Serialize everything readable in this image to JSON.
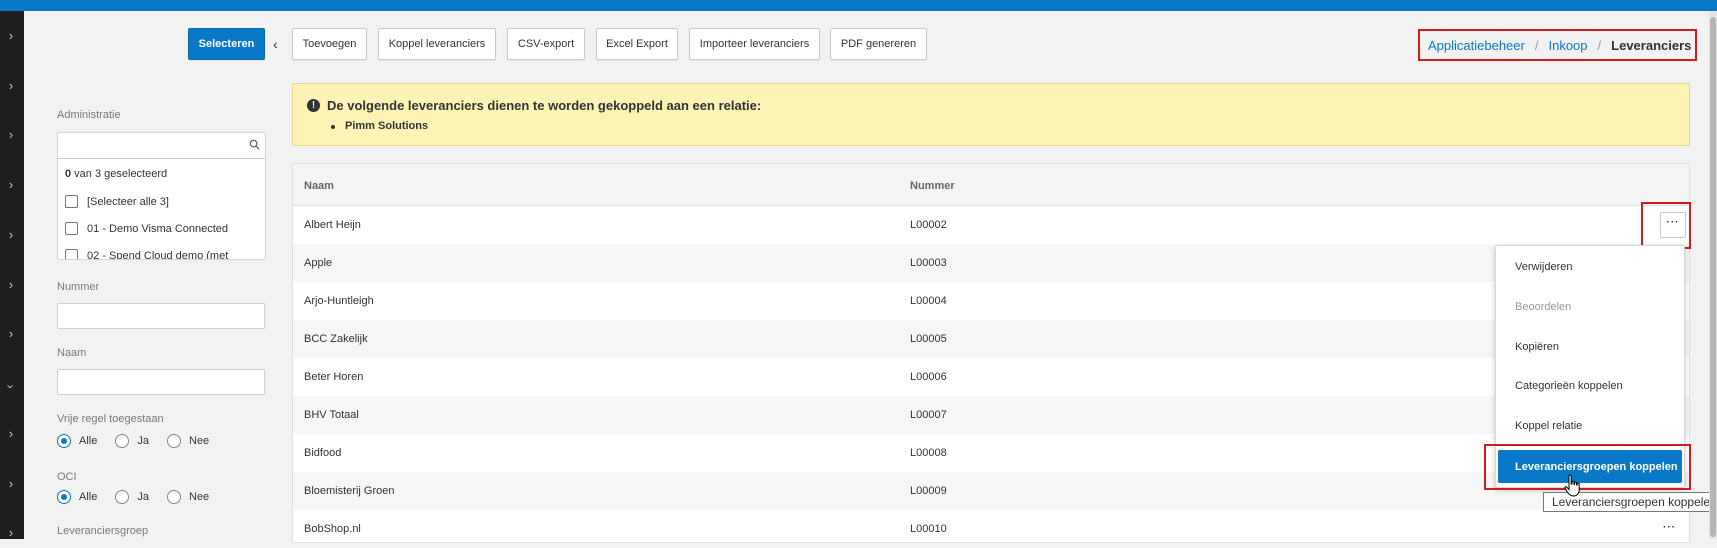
{
  "toolbar": {
    "select_label": "Selecteren",
    "buttons": [
      "Toevoegen",
      "Koppel leveranciers",
      "CSV-export",
      "Excel Export",
      "Importeer leveranciers",
      "PDF genereren"
    ]
  },
  "breadcrumb": {
    "items": [
      "Applicatiebeheer",
      "Inkoop"
    ],
    "current": "Leveranciers",
    "separator": "/"
  },
  "filters": {
    "administratie_label": "Administratie",
    "admin_count_number": "0",
    "admin_count_text": " van 3 geselecteerd",
    "admin_options": [
      "[Selecteer alle 3]",
      "01 - Demo Visma Connected",
      "02 - Spend Cloud demo (met"
    ],
    "nummer_label": "Nummer",
    "naam_label": "Naam",
    "vrije_regel_label": "Vrije regel toegestaan",
    "oci_label": "OCI",
    "radio_options": [
      "Alle",
      "Ja",
      "Nee"
    ],
    "leveranciersgroep_label": "Leveranciersgroep"
  },
  "alert": {
    "title": "De volgende leveranciers dienen te worden gekoppeld aan een relatie:",
    "items": [
      "Pimm Solutions"
    ]
  },
  "table": {
    "columns": [
      "Naam",
      "Nummer"
    ],
    "rows": [
      {
        "naam": "Albert Heijn",
        "nummer": "L00002"
      },
      {
        "naam": "Apple",
        "nummer": "L00003"
      },
      {
        "naam": "Arjo-Huntleigh",
        "nummer": "L00004"
      },
      {
        "naam": "BCC Zakelijk",
        "nummer": "L00005"
      },
      {
        "naam": "Beter Horen",
        "nummer": "L00006"
      },
      {
        "naam": "BHV Totaal",
        "nummer": "L00007"
      },
      {
        "naam": "Bidfood",
        "nummer": "L00008"
      },
      {
        "naam": "Bloemisterij Groen",
        "nummer": "L00009"
      },
      {
        "naam": "BobShop.nl",
        "nummer": "L00010"
      }
    ],
    "row_menu_label": "···"
  },
  "dropdown": {
    "items": [
      "Verwijderen",
      "Beoordelen",
      "Kopiëren",
      "Categorieën koppelen",
      "Koppel relatie"
    ],
    "active_item": "Leveranciersgroepen koppelen"
  },
  "tooltip": "Leveranciersgroepen koppelen",
  "colors": {
    "accent": "#0a78c8",
    "highlight": "#d01c1c",
    "alert_bg": "#fcf3b5"
  }
}
